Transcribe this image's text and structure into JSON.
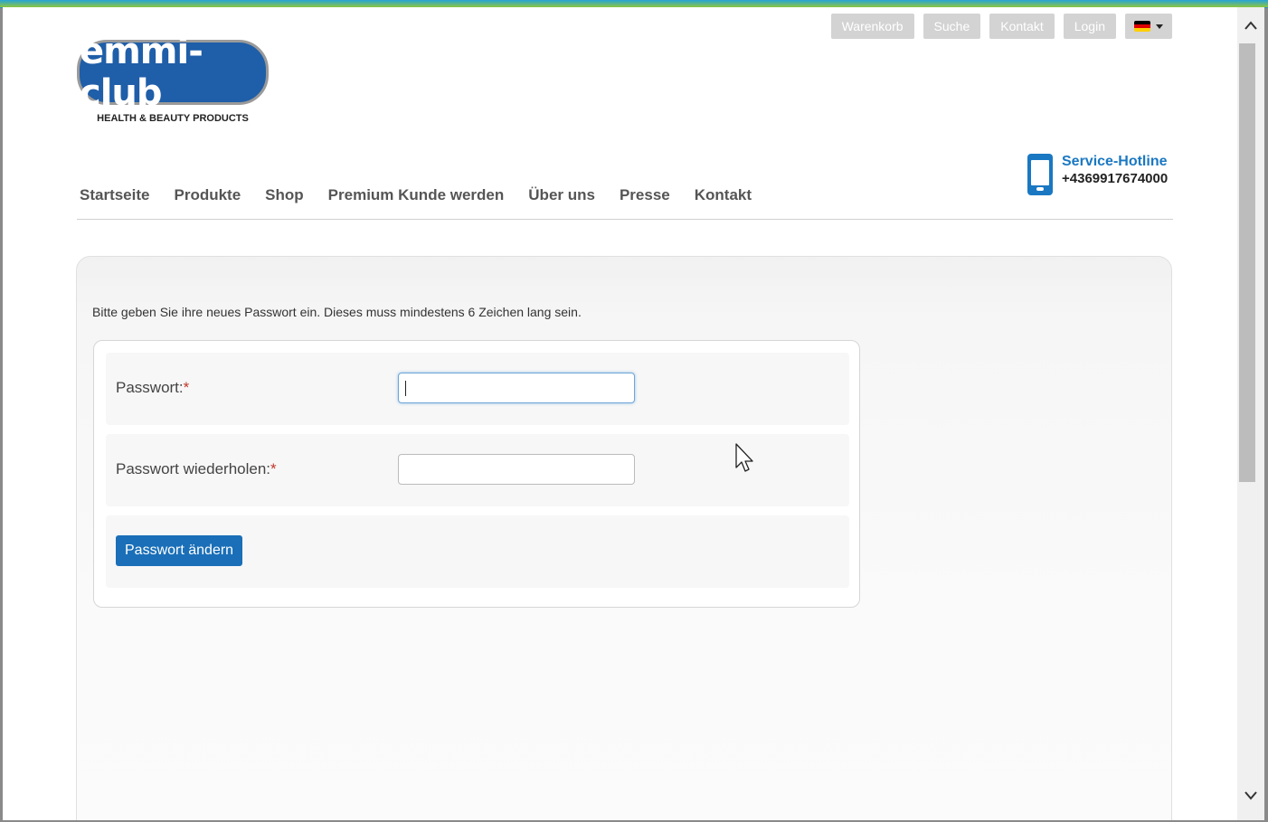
{
  "utility_nav": {
    "items": [
      "Warenkorb",
      "Suche",
      "Kontakt",
      "Login"
    ],
    "language_icon": "flag-de-icon"
  },
  "logo": {
    "name": "emmi-club",
    "tagline": "HEALTH & BEAUTY PRODUCTS"
  },
  "hotline": {
    "title": "Service-Hotline",
    "phone": "+4369917674000"
  },
  "main_nav": {
    "items": [
      "Startseite",
      "Produkte",
      "Shop",
      "Premium Kunde werden",
      "Über uns",
      "Presse",
      "Kontakt"
    ]
  },
  "password_form": {
    "intro": "Bitte geben Sie ihre neues Passwort ein. Dieses muss mindestens 6 Zeichen lang sein.",
    "password_label": "Passwort:",
    "password_value": "",
    "repeat_label": "Passwort wiederholen:",
    "repeat_value": "",
    "required_marker": "*",
    "submit_label": "Passwort ändern"
  },
  "colors": {
    "brand_blue": "#1f5ea8",
    "accent_blue": "#1a78c2",
    "button_blue": "#1a6fb8"
  }
}
